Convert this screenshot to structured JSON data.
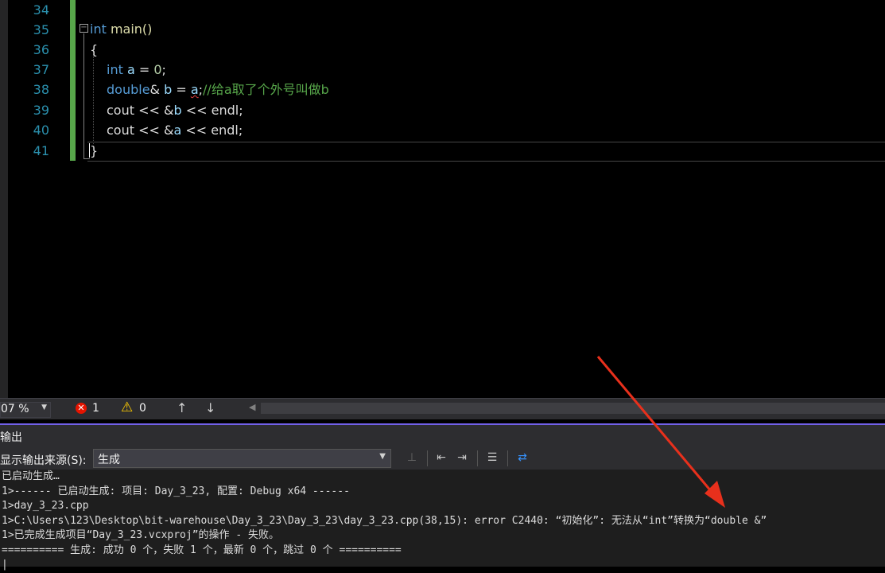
{
  "editor": {
    "line_numbers": [
      "34",
      "35",
      "36",
      "37",
      "38",
      "39",
      "40",
      "41"
    ],
    "code": {
      "l35_type": "int",
      "l35_name": "main()",
      "l36": "{",
      "l37_type": "int",
      "l37_var": "a",
      "l37_op": " = ",
      "l37_num": "0",
      "l37_end": ";",
      "l38_type": "double",
      "l38_amp": "& ",
      "l38_var_b": "b",
      "l38_op": " = ",
      "l38_var_a": "a",
      "l38_semicolon": ";",
      "l38_comment": "//给a取了个外号叫做b",
      "l39_a": "cout << &",
      "l39_b": "b",
      "l39_c": " << endl;",
      "l40_a": "cout << &",
      "l40_b": "a",
      "l40_c": " << endl;",
      "l41": "}"
    }
  },
  "statusbar": {
    "zoom": "07 %",
    "error_count": "1",
    "warning_count": "0"
  },
  "output": {
    "title": "输出",
    "source_label": "显示输出来源(S):",
    "source_value": "生成",
    "lines": [
      "已启动生成…",
      "1>------ 已启动生成: 项目: Day_3_23, 配置: Debug x64 ------",
      "1>day_3_23.cpp",
      "1>C:\\Users\\123\\Desktop\\bit-warehouse\\Day_3_23\\Day_3_23\\day_3_23.cpp(38,15): error C2440: “初始化”: 无法从“int”转换为“double &”",
      "1>已完成生成项目“Day_3_23.vcxproj”的操作 - 失败。",
      "========== 生成: 成功 0 个，失败 1 个，最新 0 个，跳过 0 个 ==========",
      "|"
    ]
  },
  "annotation": {
    "arrow_color": "#e8301c"
  }
}
